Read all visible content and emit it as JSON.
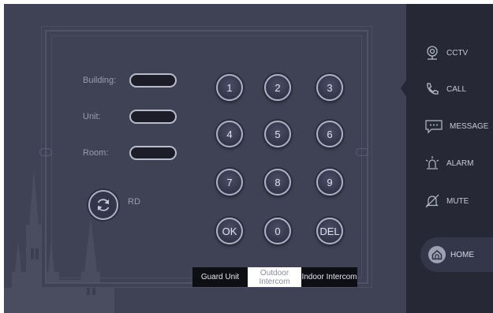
{
  "form": {
    "building_label": "Building:",
    "unit_label": "Unit:",
    "room_label": "Room:"
  },
  "rd": {
    "label": "RD"
  },
  "keypad": {
    "keys": [
      "1",
      "2",
      "3",
      "4",
      "5",
      "6",
      "7",
      "8",
      "9",
      "OK",
      "0",
      "DEL"
    ]
  },
  "tabs": {
    "guard_unit": "Guard Unit",
    "outdoor_intercom": "Outdoor Intercom",
    "indoor_intercom": "Indoor Intercom"
  },
  "sidebar": {
    "cctv": "CCTV",
    "call": "CALL",
    "message": "MESSAGE",
    "alarm": "ALARM",
    "mute": "MUTE",
    "home": "HOME"
  },
  "colors": {
    "main_bg": "#3f4254",
    "sidebar_bg": "#262835",
    "active_tab": "#ffffff"
  }
}
